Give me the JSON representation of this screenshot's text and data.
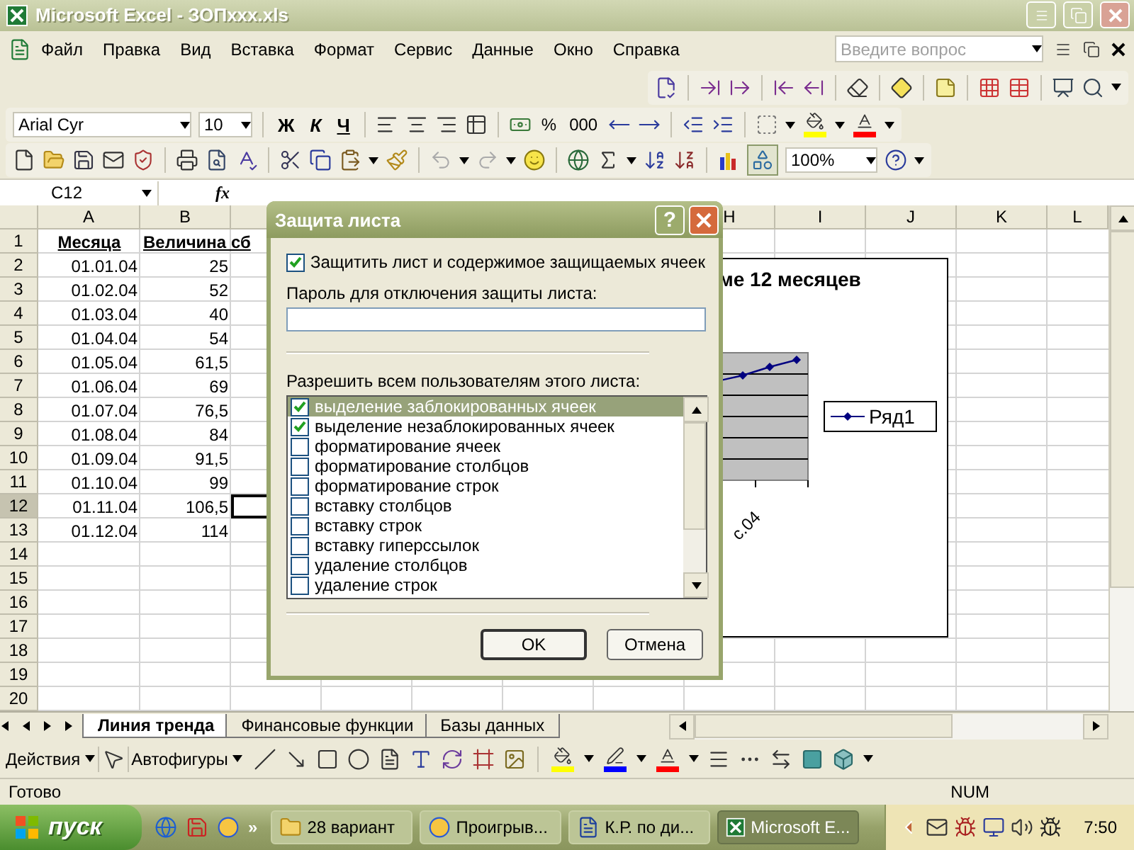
{
  "window": {
    "title": "Microsoft Excel - ЗОПxxx.xls"
  },
  "menu": [
    "Файл",
    "Правка",
    "Вид",
    "Вставка",
    "Формат",
    "Сервис",
    "Данные",
    "Окно",
    "Справка"
  ],
  "help_search": {
    "placeholder": "Введите вопрос"
  },
  "format_toolbar": {
    "font": "Arial Cyr",
    "size": "10",
    "bold": "Ж",
    "italic": "К",
    "underline": "Ч",
    "percent": "%",
    "thousands": "000"
  },
  "standard_toolbar": {
    "zoom": "100%"
  },
  "formula_bar": {
    "name_box": "C12",
    "fx": "fx"
  },
  "sheet": {
    "columns": [
      "A",
      "B",
      "H",
      "I",
      "J",
      "K",
      "L"
    ],
    "rows": [
      {
        "number": "1",
        "kind": "header",
        "a": "Месяца",
        "b": "Величина сб",
        "selected": false
      },
      {
        "number": "2",
        "kind": "data",
        "a": "01.01.04",
        "b": "25",
        "selected": false
      },
      {
        "number": "3",
        "kind": "data",
        "a": "01.02.04",
        "b": "52",
        "selected": false
      },
      {
        "number": "4",
        "kind": "data",
        "a": "01.03.04",
        "b": "40",
        "selected": false
      },
      {
        "number": "5",
        "kind": "data",
        "a": "01.04.04",
        "b": "54",
        "selected": false
      },
      {
        "number": "6",
        "kind": "data",
        "a": "01.05.04",
        "b": "61,5",
        "selected": false
      },
      {
        "number": "7",
        "kind": "data",
        "a": "01.06.04",
        "b": "69",
        "selected": false
      },
      {
        "number": "8",
        "kind": "data",
        "a": "01.07.04",
        "b": "76,5",
        "selected": false
      },
      {
        "number": "9",
        "kind": "data",
        "a": "01.08.04",
        "b": "84",
        "selected": false
      },
      {
        "number": "10",
        "kind": "data",
        "a": "01.09.04",
        "b": "91,5",
        "selected": false
      },
      {
        "number": "11",
        "kind": "data",
        "a": "01.10.04",
        "b": "99",
        "selected": false
      },
      {
        "number": "12",
        "kind": "data",
        "a": "01.11.04",
        "b": "106,5",
        "selected": true
      },
      {
        "number": "13",
        "kind": "data",
        "a": "01.12.04",
        "b": "114",
        "selected": false
      },
      {
        "number": "14",
        "kind": "empty",
        "selected": false
      },
      {
        "number": "15",
        "kind": "empty",
        "selected": false
      },
      {
        "number": "16",
        "kind": "empty",
        "selected": false
      },
      {
        "number": "17",
        "kind": "empty",
        "selected": false
      },
      {
        "number": "18",
        "kind": "empty",
        "selected": false
      },
      {
        "number": "19",
        "kind": "empty",
        "selected": false
      },
      {
        "number": "20",
        "kind": "empty",
        "selected": false
      }
    ]
  },
  "chart": {
    "title": "ме 12 месяцев",
    "axis_label": "с.04",
    "legend": "Ряд1"
  },
  "dialog": {
    "title": "Защита листа",
    "help_button": "?",
    "protect": {
      "label": "Защитить лист и содержимое защищаемых ячеек",
      "checked": true
    },
    "password": {
      "label": "Пароль для отключения защиты листа:"
    },
    "permissions_label": "Разрешить всем пользователям этого листа:",
    "permissions": [
      {
        "label": "выделение заблокированных ячеек",
        "checked": true,
        "selected": true
      },
      {
        "label": "выделение незаблокированных ячеек",
        "checked": true,
        "selected": false
      },
      {
        "label": "форматирование ячеек",
        "checked": false,
        "selected": false
      },
      {
        "label": "форматирование столбцов",
        "checked": false,
        "selected": false
      },
      {
        "label": "форматирование строк",
        "checked": false,
        "selected": false
      },
      {
        "label": "вставку столбцов",
        "checked": false,
        "selected": false
      },
      {
        "label": "вставку строк",
        "checked": false,
        "selected": false
      },
      {
        "label": "вставку гиперссылок",
        "checked": false,
        "selected": false
      },
      {
        "label": "удаление столбцов",
        "checked": false,
        "selected": false
      },
      {
        "label": "удаление строк",
        "checked": false,
        "selected": false
      }
    ],
    "buttons": [
      {
        "label": "OK",
        "default": true
      },
      {
        "label": "Отмена",
        "default": false
      }
    ]
  },
  "sheet_tabs": [
    {
      "label": "Линия тренда",
      "selected": true
    },
    {
      "label": "Финансовые функции",
      "selected": false
    },
    {
      "label": "Базы данных",
      "selected": false
    }
  ],
  "drawing_toolbar": {
    "actions": "Действия",
    "autoshapes": "Автофигуры"
  },
  "status_bar": {
    "status": "Готово",
    "num": "NUM"
  },
  "taskbar": {
    "start": "пуск",
    "more": "»",
    "tasks": [
      {
        "label": "28 вариант",
        "kind": "folder",
        "selected": false
      },
      {
        "label": "Проигрыв...",
        "kind": "player",
        "selected": false
      },
      {
        "label": "К.Р. по ди...",
        "kind": "word",
        "selected": false
      },
      {
        "label": "Microsoft E...",
        "kind": "excel",
        "selected": true
      }
    ],
    "clock": "7:50"
  }
}
